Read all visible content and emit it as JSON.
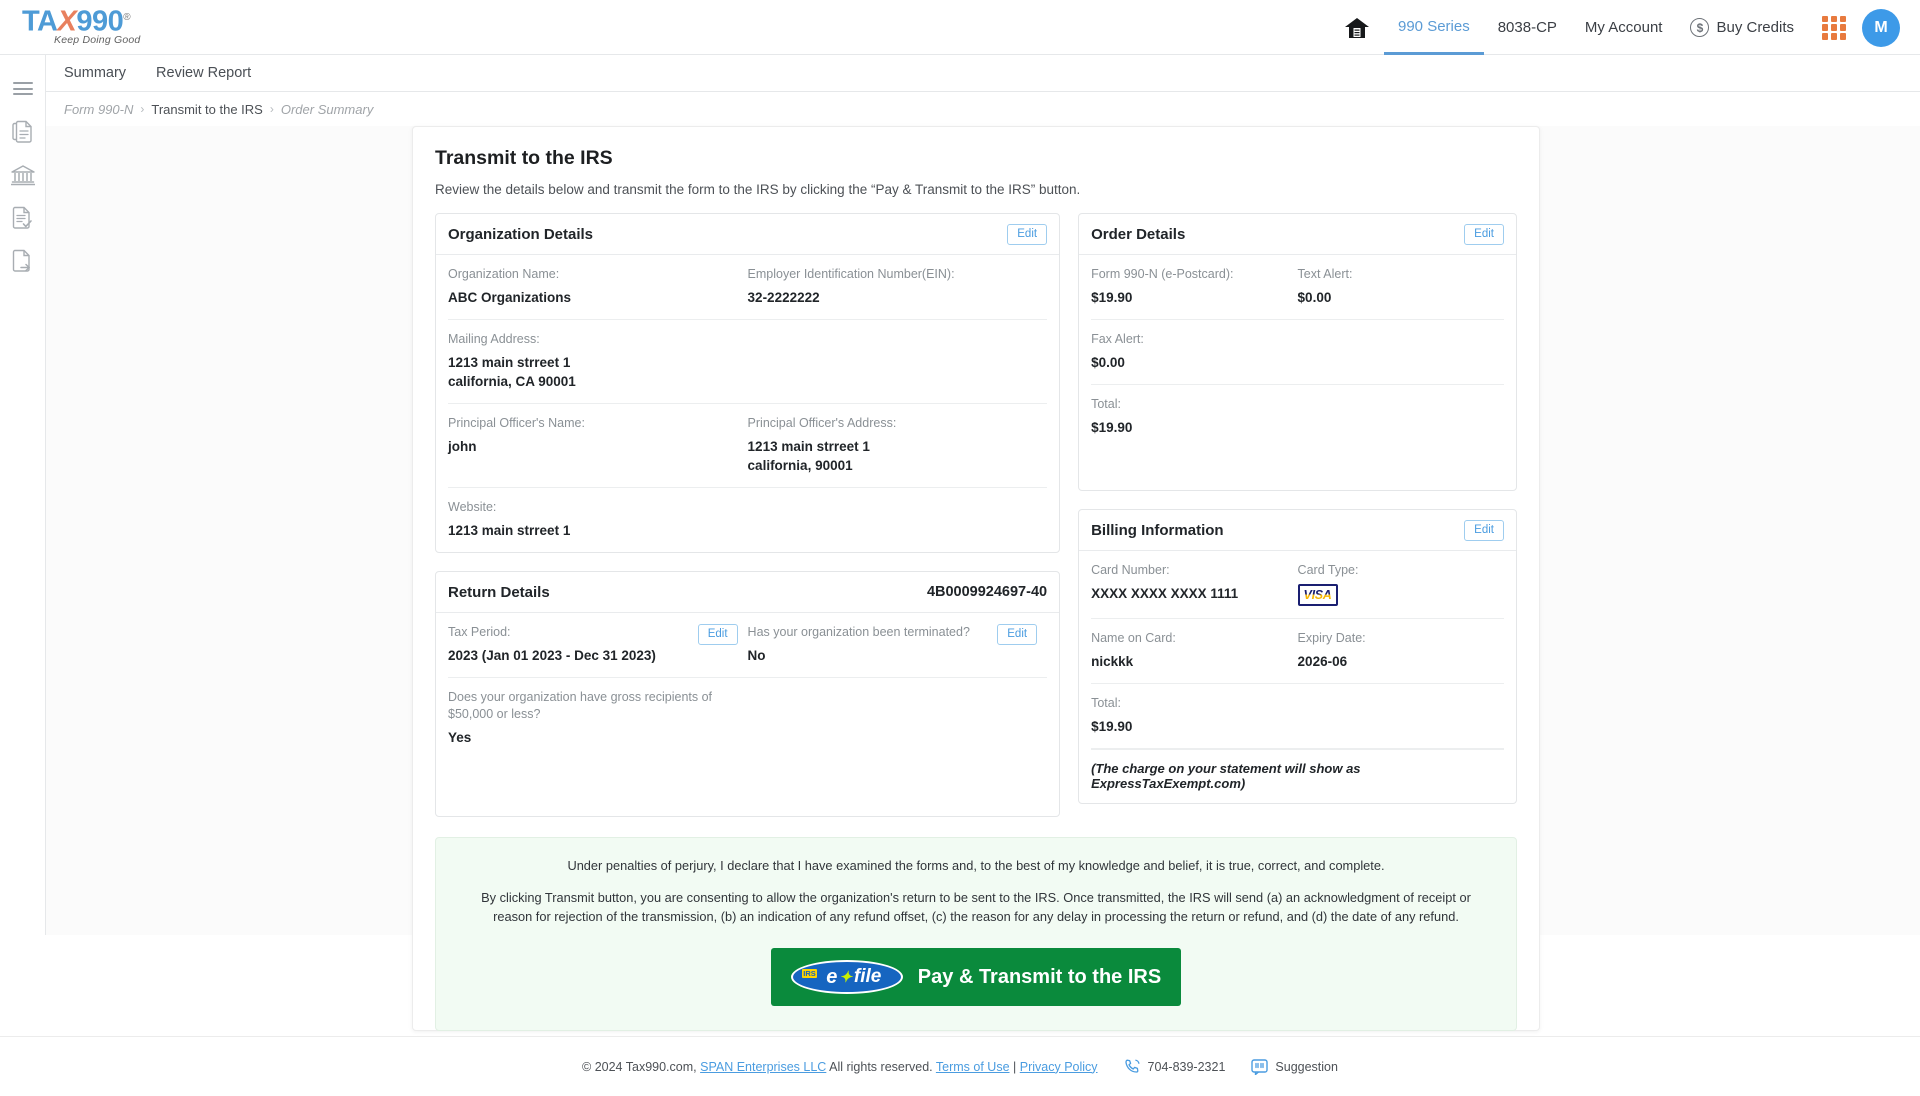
{
  "brand": {
    "logo_t": "TA",
    "logo_x": "X",
    "logo_990": "990",
    "logo_reg": "®",
    "tagline": "Keep Doing Good"
  },
  "topnav": {
    "home_icon": "home-icon",
    "items": [
      {
        "label": "990 Series",
        "active": true
      },
      {
        "label": "8038-CP",
        "active": false
      },
      {
        "label": "My Account",
        "active": false
      }
    ],
    "credits_label": "Buy Credits",
    "credits_symbol": "$",
    "avatar_initial": "M"
  },
  "rail": {
    "items": [
      {
        "name": "menu-toggle"
      },
      {
        "name": "documents-icon"
      },
      {
        "name": "bank-icon"
      },
      {
        "name": "document-check-icon"
      },
      {
        "name": "document-export-icon"
      }
    ]
  },
  "subtabs": [
    {
      "label": "Summary"
    },
    {
      "label": "Review Report"
    }
  ],
  "breadcrumb": [
    {
      "label": "Form 990-N",
      "current": false
    },
    {
      "label": "Transmit to the IRS",
      "current": true
    },
    {
      "label": "Order Summary",
      "current": false
    }
  ],
  "breadcrumb_sep": "›",
  "page": {
    "title": "Transmit to the IRS",
    "subtitle": "Review the details below and transmit the form to the IRS by clicking the “Pay & Transmit to the IRS” button."
  },
  "edit_label": "Edit",
  "organization": {
    "title": "Organization Details",
    "name_label": "Organization Name:",
    "name_value": "ABC Organizations",
    "ein_label": "Employer Identification Number(EIN):",
    "ein_value": "32-2222222",
    "mailing_label": "Mailing Address:",
    "mailing_line1": "1213 main strreet 1",
    "mailing_line2": "california, CA 90001",
    "officer_name_label": "Principal Officer's Name:",
    "officer_name_value": "john",
    "officer_addr_label": "Principal Officer's Address:",
    "officer_addr_line1": "1213 main strreet 1",
    "officer_addr_line2": "california, 90001",
    "website_label": "Website:",
    "website_value": "1213 main strreet 1"
  },
  "order": {
    "title": "Order Details",
    "form_label": "Form 990-N (e-Postcard):",
    "form_value": "$19.90",
    "text_alert_label": "Text Alert:",
    "text_alert_value": "$0.00",
    "fax_alert_label": "Fax Alert:",
    "fax_alert_value": "$0.00",
    "total_label": "Total:",
    "total_value": "$19.90"
  },
  "return_details": {
    "title": "Return Details",
    "submission_id": "4B0009924697-40",
    "tax_period_label": "Tax Period:",
    "tax_period_value": "2023 (Jan 01 2023 - Dec 31 2023)",
    "terminated_label": "Has your organization been terminated?",
    "terminated_value": "No",
    "gross_label": "Does your organization have gross recipients of $50,000 or less?",
    "gross_value": "Yes"
  },
  "billing": {
    "title": "Billing Information",
    "card_number_label": "Card Number:",
    "card_number_value": "XXXX XXXX XXXX 1111",
    "card_type_label": "Card Type:",
    "card_type_value": "VISA",
    "name_label": "Name on Card:",
    "name_value": "nickkk",
    "expiry_label": "Expiry Date:",
    "expiry_value": "2026-06",
    "total_label": "Total:",
    "total_value": "$19.90",
    "statement_note": "(The charge on your statement will show as ExpressTaxExempt.com)"
  },
  "consent": {
    "line1": "Under penalties of perjury, I declare that I have examined the forms and, to the best of my knowledge and belief, it is true, correct, and complete.",
    "line2": "By clicking Transmit button, you are consenting to allow the organization's return to be sent to the IRS. Once transmitted, the IRS will send (a) an acknowledgment of receipt or reason for rejection of the transmission, (b) an indication of any refund offset, (c) the reason for any delay in processing the return or refund, and (d) the date of any refund.",
    "button_label": "Pay & Transmit to the IRS",
    "badge_irs": "IRS",
    "badge_e": "e",
    "badge_bolt": "✦",
    "badge_file": "file"
  },
  "footer": {
    "copyright": "© 2024 Tax990.com,",
    "company_link": "SPAN Enterprises LLC",
    "rights": "All rights reserved.",
    "terms": "Terms of Use",
    "divider": "|",
    "privacy": "Privacy Policy",
    "phone": "704-839-2321",
    "suggestion": "Suggestion"
  },
  "colors": {
    "accent_blue": "#4a9ce0",
    "brand_blue": "#4e9bd6",
    "brand_orange": "#e8805e",
    "efile_green": "#0a8a3c",
    "consent_bg": "#f2fbf3"
  }
}
